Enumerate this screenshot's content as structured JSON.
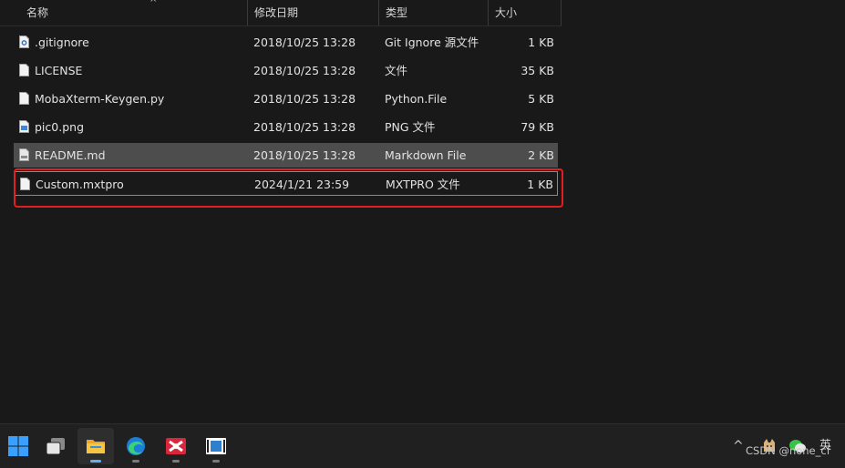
{
  "columns": {
    "name": "名称",
    "date": "修改日期",
    "type": "类型",
    "size": "大小",
    "sort_indicator": "^"
  },
  "files": [
    {
      "name": ".gitignore",
      "date": "2018/10/25 13:28",
      "type": "Git Ignore 源文件",
      "size": "1 KB",
      "icon": "gear-file-icon"
    },
    {
      "name": "LICENSE",
      "date": "2018/10/25 13:28",
      "type": "文件",
      "size": "35 KB",
      "icon": "blank-file-icon"
    },
    {
      "name": "MobaXterm-Keygen.py",
      "date": "2018/10/25 13:28",
      "type": "Python.File",
      "size": "5 KB",
      "icon": "blank-file-icon"
    },
    {
      "name": "pic0.png",
      "date": "2018/10/25 13:28",
      "type": "PNG 文件",
      "size": "79 KB",
      "icon": "image-file-icon"
    },
    {
      "name": "README.md",
      "date": "2018/10/25 13:28",
      "type": "Markdown File",
      "size": "2 KB",
      "icon": "markdown-file-icon",
      "selected": true
    },
    {
      "name": "Custom.mxtpro",
      "date": "2024/1/21 23:59",
      "type": "MXTPRO 文件",
      "size": "1 KB",
      "icon": "blank-file-icon",
      "focused": true
    }
  ],
  "taskbar": {
    "apps": [
      "windows-start-icon",
      "task-view-icon",
      "file-explorer-icon",
      "edge-browser-icon",
      "mobaxterm-icon",
      "media-app-icon"
    ],
    "tray_chevron": "^",
    "ime": "英"
  },
  "watermark": "CSDN @none_cf",
  "colors": {
    "highlight": "#e02020",
    "selected_row": "#4d4d4d",
    "taskbar": "#202020"
  }
}
